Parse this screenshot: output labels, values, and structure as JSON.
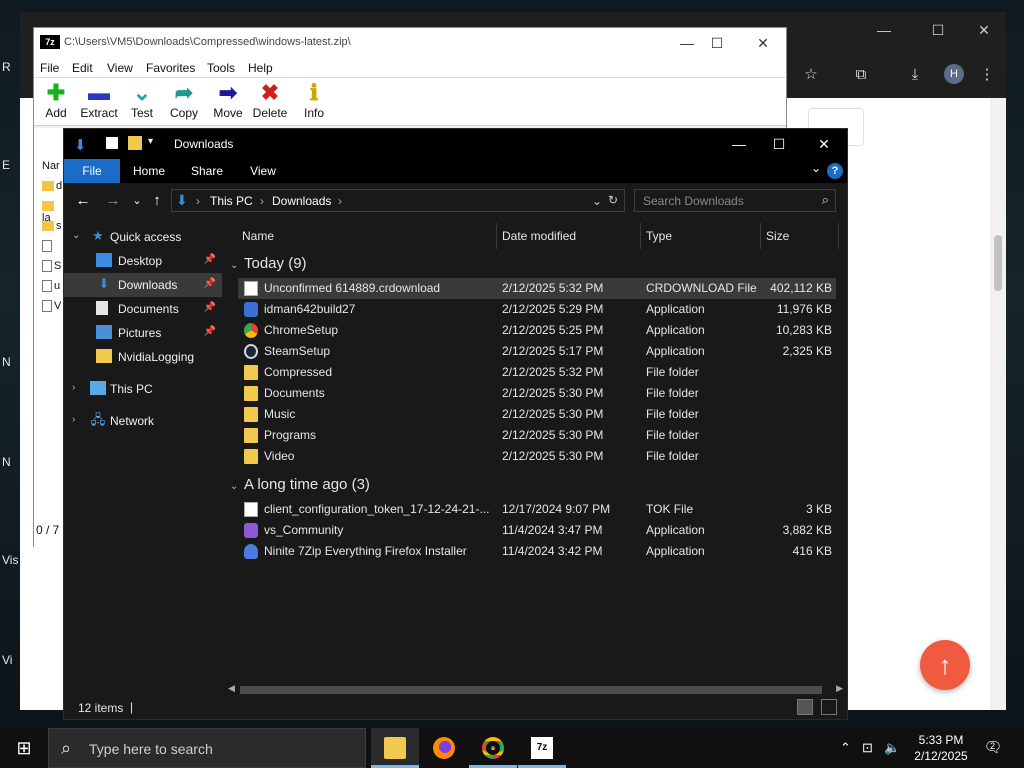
{
  "desktop": {
    "fragments": [
      "R",
      "E",
      "N",
      "N",
      "N",
      "Vis",
      "Vi"
    ]
  },
  "chrome": {
    "caption": {
      "minimize": "—",
      "maximize": "☐",
      "close": "✕"
    },
    "toolbar": {
      "bookmark": "☆",
      "extensions": "⧉",
      "download": "⤓",
      "avatar": "H",
      "menu": "⋮"
    },
    "fab_icon": "↑"
  },
  "zip": {
    "logo": "7z",
    "title": "C:\\Users\\VM5\\Downloads\\Compressed\\windows-latest.zip\\",
    "caption": {
      "minimize": "—",
      "maximize": "☐",
      "close": "✕"
    },
    "menu": [
      "File",
      "Edit",
      "View",
      "Favorites",
      "Tools",
      "Help"
    ],
    "toolbar": [
      {
        "label": "Add",
        "icon": "✚",
        "color": "#1ab01a"
      },
      {
        "label": "Extract",
        "icon": "▬",
        "color": "#2a36c4"
      },
      {
        "label": "Test",
        "icon": "⌄",
        "color": "#14a8b0"
      },
      {
        "label": "Copy",
        "icon": "➦",
        "color": "#1d9a8a"
      },
      {
        "label": "Move",
        "icon": "➡",
        "color": "#1a1a9c"
      },
      {
        "label": "Delete",
        "icon": "✖",
        "color": "#d0201c"
      },
      {
        "label": "Info",
        "icon": "ℹ",
        "color": "#c9a800"
      }
    ],
    "left_header": "Nar",
    "left_rows": [
      "d",
      "la",
      "s",
      "",
      "S",
      "u",
      "V"
    ],
    "status": "0 / 7"
  },
  "explorer": {
    "title": "Downloads",
    "caption": {
      "minimize": "—",
      "maximize": "☐",
      "close": "✕"
    },
    "ribbon": {
      "file": "File",
      "home": "Home",
      "share": "Share",
      "view": "View",
      "help": "?"
    },
    "nav": {
      "back": "←",
      "forward": "→",
      "recent": "⌄",
      "up": "↑"
    },
    "address": {
      "segments": [
        "This PC",
        "Downloads"
      ],
      "separator": "›",
      "refresh": "↻"
    },
    "search": {
      "placeholder": "Search Downloads",
      "icon": "⌕"
    },
    "navpane": [
      {
        "label": "Quick access",
        "pinned": false,
        "selected": false
      },
      {
        "label": "Desktop",
        "pinned": true,
        "selected": false
      },
      {
        "label": "Downloads",
        "pinned": true,
        "selected": true
      },
      {
        "label": "Documents",
        "pinned": true,
        "selected": false
      },
      {
        "label": "Pictures",
        "pinned": true,
        "selected": false
      },
      {
        "label": "NvidiaLogging",
        "pinned": false,
        "selected": false
      },
      {
        "label": "This PC",
        "pinned": false,
        "selected": false
      },
      {
        "label": "Network",
        "pinned": false,
        "selected": false
      }
    ],
    "columns": [
      "Name",
      "Date modified",
      "Type",
      "Size"
    ],
    "groups": [
      {
        "label": "Today (9)",
        "files": [
          {
            "name": "Unconfirmed 614889.crdownload",
            "date": "2/12/2025 5:32 PM",
            "type": "CRDOWNLOAD File",
            "size": "402,112 KB",
            "icon": "doc",
            "selected": true
          },
          {
            "name": "idman642build27",
            "date": "2/12/2025 5:29 PM",
            "type": "Application",
            "size": "11,976 KB",
            "icon": "app",
            "selected": false
          },
          {
            "name": "ChromeSetup",
            "date": "2/12/2025 5:25 PM",
            "type": "Application",
            "size": "10,283 KB",
            "icon": "chrome",
            "selected": false
          },
          {
            "name": "SteamSetup",
            "date": "2/12/2025 5:17 PM",
            "type": "Application",
            "size": "2,325 KB",
            "icon": "steam",
            "selected": false
          },
          {
            "name": "Compressed",
            "date": "2/12/2025 5:32 PM",
            "type": "File folder",
            "size": "",
            "icon": "folder",
            "selected": false
          },
          {
            "name": "Documents",
            "date": "2/12/2025 5:30 PM",
            "type": "File folder",
            "size": "",
            "icon": "folder",
            "selected": false
          },
          {
            "name": "Music",
            "date": "2/12/2025 5:30 PM",
            "type": "File folder",
            "size": "",
            "icon": "folder",
            "selected": false
          },
          {
            "name": "Programs",
            "date": "2/12/2025 5:30 PM",
            "type": "File folder",
            "size": "",
            "icon": "folder",
            "selected": false
          },
          {
            "name": "Video",
            "date": "2/12/2025 5:30 PM",
            "type": "File folder",
            "size": "",
            "icon": "folder",
            "selected": false
          }
        ]
      },
      {
        "label": "A long time ago (3)",
        "files": [
          {
            "name": "client_configuration_token_17-12-24-21-...",
            "date": "12/17/2024 9:07 PM",
            "type": "TOK File",
            "size": "3 KB",
            "icon": "doc",
            "selected": false
          },
          {
            "name": "vs_Community",
            "date": "11/4/2024 3:47 PM",
            "type": "Application",
            "size": "3,882 KB",
            "icon": "vs",
            "selected": false
          },
          {
            "name": "Ninite 7Zip Everything Firefox Installer",
            "date": "11/4/2024 3:42 PM",
            "type": "Application",
            "size": "416 KB",
            "icon": "ninite",
            "selected": false
          }
        ]
      }
    ],
    "status": "12 items"
  },
  "taskbar": {
    "start_icon": "⊞",
    "search_icon": "⌕",
    "search_placeholder": "Type here to search",
    "apps": [
      {
        "name": "file-explorer",
        "label": "",
        "active": true
      },
      {
        "name": "firefox",
        "label": "",
        "active": false
      },
      {
        "name": "chrome",
        "label": "",
        "active": false
      },
      {
        "name": "7zip",
        "label": "7z",
        "active": false
      }
    ],
    "tray": {
      "chevron": "⌃",
      "network": "⊡",
      "volume": "🔈"
    },
    "time": "5:33 PM",
    "date": "2/12/2025",
    "notifications": "2"
  }
}
